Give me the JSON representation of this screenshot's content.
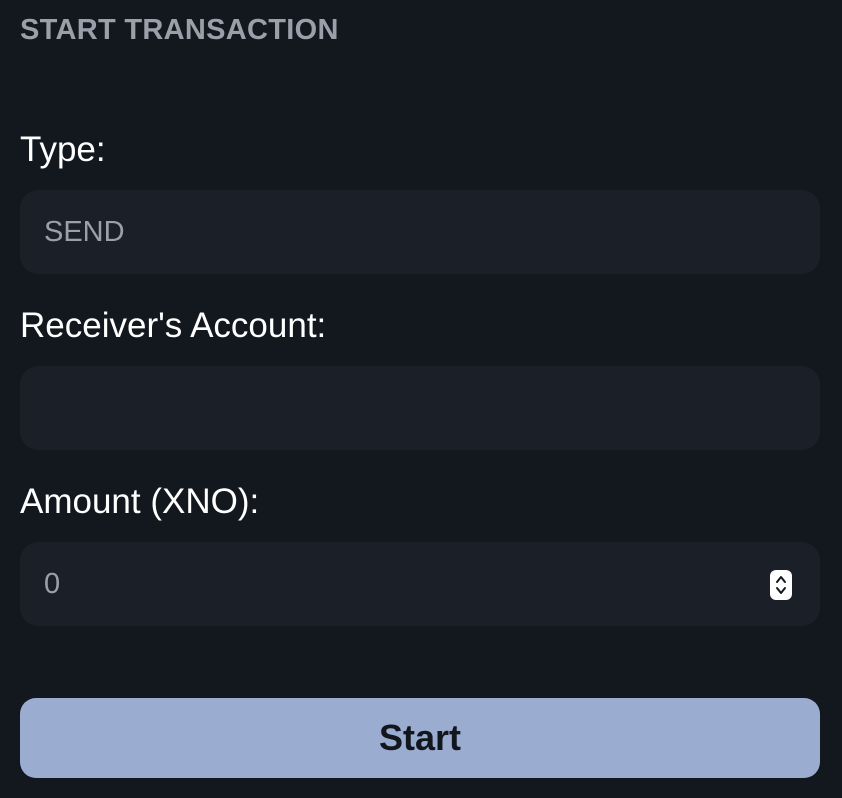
{
  "section": {
    "title": "START TRANSACTION"
  },
  "form": {
    "type": {
      "label": "Type:",
      "value": "SEND"
    },
    "receiver": {
      "label": "Receiver's Account:",
      "value": ""
    },
    "amount": {
      "label": "Amount (XNO):",
      "value": "0"
    }
  },
  "actions": {
    "start_label": "Start"
  },
  "colors": {
    "background": "#13171e",
    "field_background": "#1b2028",
    "button_background": "#9bacd1",
    "muted_text": "#9aa0a9",
    "label_text": "#ffffff"
  },
  "icons": {
    "amount_stepper": "stepper-up-down-icon"
  }
}
